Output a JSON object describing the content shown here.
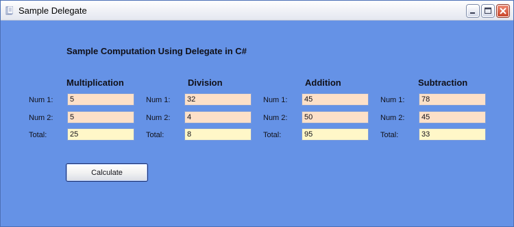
{
  "window": {
    "title": "Sample Delegate",
    "controls": {
      "minimize": "minimize",
      "maximize": "maximize",
      "close": "close"
    }
  },
  "form": {
    "heading": "Sample Computation Using Delegate in C#",
    "labels": {
      "num1": "Num 1:",
      "num2": "Num 2:",
      "total": "Total:"
    },
    "sections": [
      {
        "title": "Multiplication",
        "num1": "5",
        "num2": "5",
        "total": "25"
      },
      {
        "title": "Division",
        "num1": "32",
        "num2": "4",
        "total": "8"
      },
      {
        "title": "Addition",
        "num1": "45",
        "num2": "50",
        "total": "95"
      },
      {
        "title": "Subtraction",
        "num1": "78",
        "num2": "45",
        "total": "33"
      }
    ],
    "calculate_label": "Calculate"
  },
  "colors": {
    "client_background": "#6592e6",
    "input_background": "#fde0c8",
    "total_background": "#fff7c8"
  }
}
